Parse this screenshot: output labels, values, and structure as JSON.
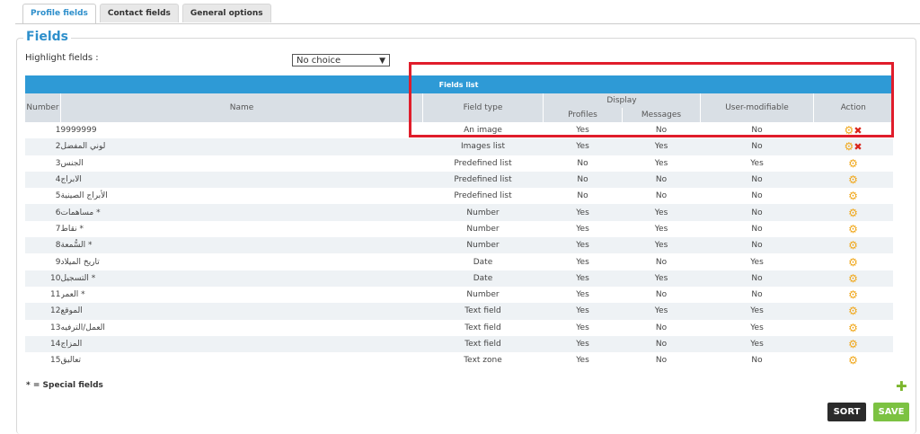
{
  "tabs": [
    {
      "label": "Profile fields",
      "active": true
    },
    {
      "label": "Contact fields",
      "active": false
    },
    {
      "label": "General options",
      "active": false
    }
  ],
  "fieldset_title": "Fields",
  "highlight": {
    "label": "Highlight fields :",
    "selected": "No choice"
  },
  "table": {
    "title": "Fields list",
    "headers": {
      "number": "Number",
      "name": "Name",
      "field_type": "Field type",
      "display": "Display",
      "profiles": "Profiles",
      "messages": "Messages",
      "user_modifiable": "User-modifiable",
      "action": "Action"
    },
    "rows": [
      {
        "number": "1",
        "name": "9999999",
        "type": "An image",
        "profiles": "Yes",
        "messages": "No",
        "modifiable": "No",
        "deletable": true
      },
      {
        "number": "2",
        "name": "لوني المفضل",
        "type": "Images list",
        "profiles": "Yes",
        "messages": "Yes",
        "modifiable": "No",
        "deletable": true
      },
      {
        "number": "3",
        "name": "الجنس",
        "type": "Predefined list",
        "profiles": "No",
        "messages": "Yes",
        "modifiable": "Yes",
        "deletable": false
      },
      {
        "number": "4",
        "name": "الابراج",
        "type": "Predefined list",
        "profiles": "No",
        "messages": "No",
        "modifiable": "No",
        "deletable": false
      },
      {
        "number": "5",
        "name": "الأبراج الصينية",
        "type": "Predefined list",
        "profiles": "No",
        "messages": "No",
        "modifiable": "No",
        "deletable": false
      },
      {
        "number": "6",
        "name": "* مساهمات",
        "type": "Number",
        "profiles": "Yes",
        "messages": "Yes",
        "modifiable": "No",
        "deletable": false
      },
      {
        "number": "7",
        "name": "* نقاط",
        "type": "Number",
        "profiles": "Yes",
        "messages": "Yes",
        "modifiable": "No",
        "deletable": false
      },
      {
        "number": "8",
        "name": "* السُّمعة",
        "type": "Number",
        "profiles": "Yes",
        "messages": "Yes",
        "modifiable": "No",
        "deletable": false
      },
      {
        "number": "9",
        "name": "تاريخ الميلاد",
        "type": "Date",
        "profiles": "Yes",
        "messages": "No",
        "modifiable": "Yes",
        "deletable": false
      },
      {
        "number": "10",
        "name": "* التسجيل",
        "type": "Date",
        "profiles": "Yes",
        "messages": "Yes",
        "modifiable": "No",
        "deletable": false
      },
      {
        "number": "11",
        "name": "* العمر",
        "type": "Number",
        "profiles": "Yes",
        "messages": "No",
        "modifiable": "No",
        "deletable": false
      },
      {
        "number": "12",
        "name": "الموقع",
        "type": "Text field",
        "profiles": "Yes",
        "messages": "Yes",
        "modifiable": "Yes",
        "deletable": false
      },
      {
        "number": "13",
        "name": "العمل/الترفيه",
        "type": "Text field",
        "profiles": "Yes",
        "messages": "No",
        "modifiable": "Yes",
        "deletable": false
      },
      {
        "number": "14",
        "name": "المزاج",
        "type": "Text field",
        "profiles": "Yes",
        "messages": "No",
        "modifiable": "Yes",
        "deletable": false
      },
      {
        "number": "15",
        "name": "تعاليق",
        "type": "Text zone",
        "profiles": "Yes",
        "messages": "No",
        "modifiable": "No",
        "deletable": false
      }
    ]
  },
  "special_note": "* = Special fields",
  "buttons": {
    "sort": "SORT",
    "save": "SAVE"
  },
  "icons": {
    "edit": "gear-icon",
    "delete": "close-icon",
    "add": "plus-icon"
  },
  "colors": {
    "accent": "#2e9ad6",
    "highlight_box": "#e01d2b",
    "save": "#7cc242",
    "sort": "#2b2b2b"
  }
}
